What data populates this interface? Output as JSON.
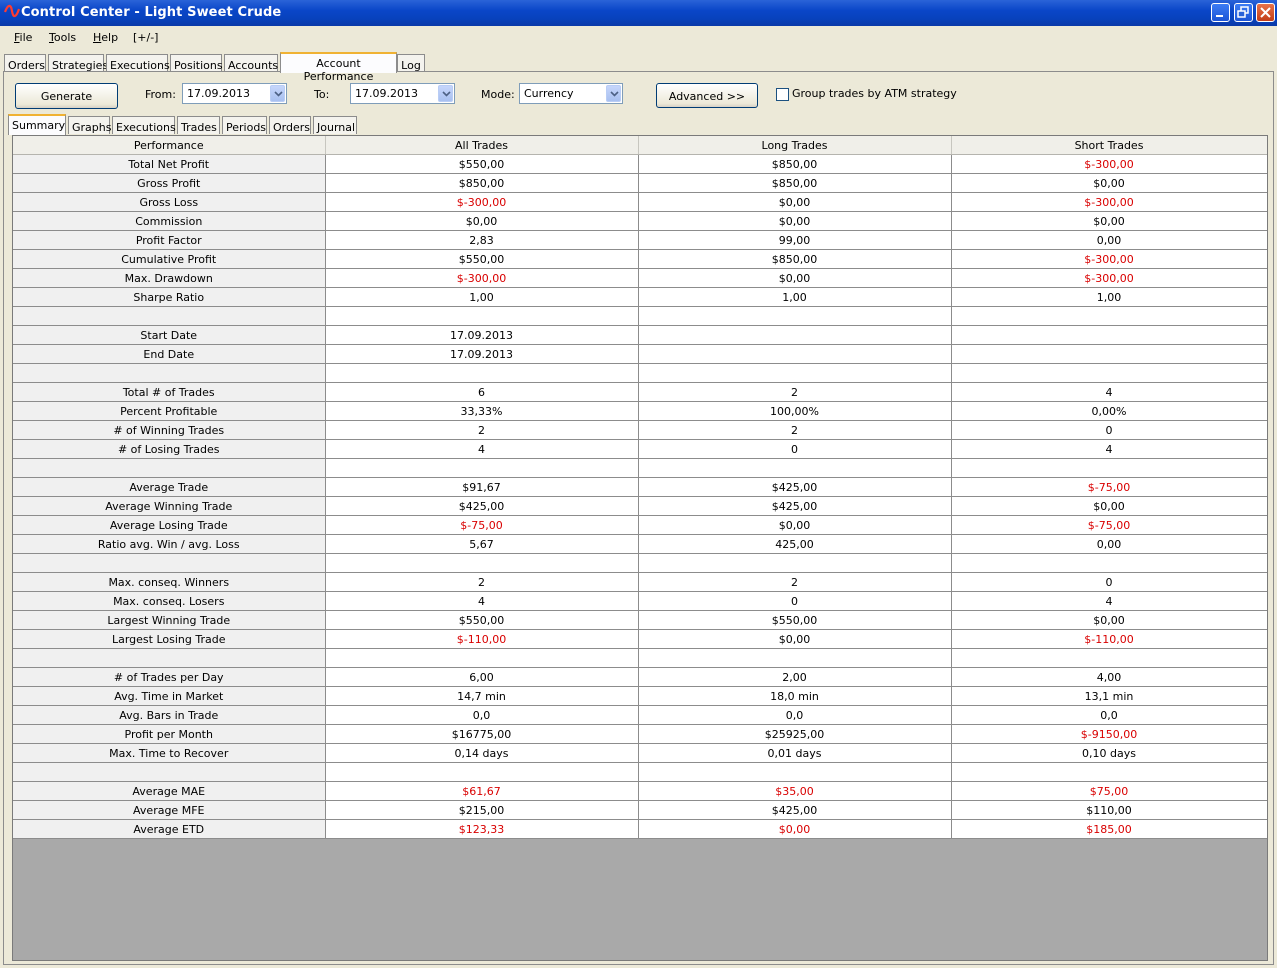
{
  "window": {
    "title": "Control Center - Light Sweet Crude"
  },
  "menu": {
    "items": [
      "File",
      "Tools",
      "Help",
      "[+/-]"
    ]
  },
  "main_tabs": [
    "Orders",
    "Strategies",
    "Executions",
    "Positions",
    "Accounts",
    "Account Performance",
    "Log"
  ],
  "main_tab_active": "Account Performance",
  "toolbar": {
    "generate_label": "Generate",
    "from_label": "From:",
    "from_value": "17.09.2013",
    "to_label": "To:",
    "to_value": "17.09.2013",
    "mode_label": "Mode:",
    "mode_value": "Currency",
    "advanced_label": "Advanced >>",
    "atm_label": "Group trades by ATM strategy",
    "atm_checked": false
  },
  "sub_tabs": [
    "Summary",
    "Graphs",
    "Executions",
    "Trades",
    "Periods",
    "Orders",
    "Journal"
  ],
  "sub_tab_active": "Summary",
  "colors": {
    "negative": "#d90000",
    "active_tab_accent": "#f0b233",
    "title_bar": "#0a46c8"
  },
  "table": {
    "columns": [
      "Performance",
      "All Trades",
      "Long Trades",
      "Short Trades"
    ],
    "rows": [
      [
        "Total Net Profit",
        "$550,00",
        "$850,00",
        "$-300,00"
      ],
      [
        "Gross Profit",
        "$850,00",
        "$850,00",
        "$0,00"
      ],
      [
        "Gross Loss",
        "$-300,00",
        "$0,00",
        "$-300,00"
      ],
      [
        "Commission",
        "$0,00",
        "$0,00",
        "$0,00"
      ],
      [
        "Profit Factor",
        "2,83",
        "99,00",
        "0,00"
      ],
      [
        "Cumulative Profit",
        "$550,00",
        "$850,00",
        "$-300,00"
      ],
      [
        "Max. Drawdown",
        "$-300,00",
        "$0,00",
        "$-300,00"
      ],
      [
        "Sharpe Ratio",
        "1,00",
        "1,00",
        "1,00"
      ],
      [
        "",
        "",
        "",
        ""
      ],
      [
        "Start Date",
        "17.09.2013",
        "",
        ""
      ],
      [
        "End Date",
        "17.09.2013",
        "",
        ""
      ],
      [
        "",
        "",
        "",
        ""
      ],
      [
        "Total # of Trades",
        "6",
        "2",
        "4"
      ],
      [
        "Percent Profitable",
        "33,33%",
        "100,00%",
        "0,00%"
      ],
      [
        "# of Winning Trades",
        "2",
        "2",
        "0"
      ],
      [
        "# of Losing Trades",
        "4",
        "0",
        "4"
      ],
      [
        "",
        "",
        "",
        ""
      ],
      [
        "Average Trade",
        "$91,67",
        "$425,00",
        "$-75,00"
      ],
      [
        "Average Winning Trade",
        "$425,00",
        "$425,00",
        "$0,00"
      ],
      [
        "Average Losing Trade",
        "$-75,00",
        "$0,00",
        "$-75,00"
      ],
      [
        "Ratio avg. Win / avg. Loss",
        "5,67",
        "425,00",
        "0,00"
      ],
      [
        "",
        "",
        "",
        ""
      ],
      [
        "Max. conseq. Winners",
        "2",
        "2",
        "0"
      ],
      [
        "Max. conseq. Losers",
        "4",
        "0",
        "4"
      ],
      [
        "Largest Winning Trade",
        "$550,00",
        "$550,00",
        "$0,00"
      ],
      [
        "Largest Losing Trade",
        "$-110,00",
        "$0,00",
        "$-110,00"
      ],
      [
        "",
        "",
        "",
        ""
      ],
      [
        "# of Trades per Day",
        "6,00",
        "2,00",
        "4,00"
      ],
      [
        "Avg. Time in Market",
        "14,7 min",
        "18,0 min",
        "13,1 min"
      ],
      [
        "Avg. Bars in Trade",
        "0,0",
        "0,0",
        "0,0"
      ],
      [
        "Profit per Month",
        "$16775,00",
        "$25925,00",
        "$-9150,00"
      ],
      [
        "Max. Time to Recover",
        "0,14 days",
        "0,01 days",
        "0,10 days"
      ],
      [
        "",
        "",
        "",
        ""
      ],
      [
        "Average MAE",
        "$61,67",
        "$35,00",
        "$75,00"
      ],
      [
        "Average MFE",
        "$215,00",
        "$425,00",
        "$110,00"
      ],
      [
        "Average ETD",
        "$123,33",
        "$0,00",
        "$185,00"
      ]
    ],
    "red_cells": [
      [
        0,
        3
      ],
      [
        2,
        1
      ],
      [
        2,
        3
      ],
      [
        5,
        3
      ],
      [
        6,
        1
      ],
      [
        6,
        3
      ],
      [
        17,
        3
      ],
      [
        19,
        1
      ],
      [
        19,
        3
      ],
      [
        25,
        1
      ],
      [
        25,
        3
      ],
      [
        30,
        3
      ],
      [
        33,
        1
      ],
      [
        33,
        2
      ],
      [
        33,
        3
      ],
      [
        35,
        1
      ],
      [
        35,
        2
      ],
      [
        35,
        3
      ]
    ]
  }
}
